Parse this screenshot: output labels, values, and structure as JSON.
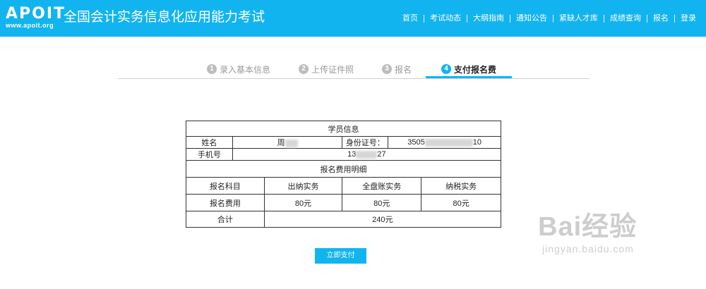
{
  "header": {
    "logo_main": "APOIT",
    "logo_sub": "www.apoit.org",
    "site_title": "全国会计实务信息化应用能力考试",
    "nav": [
      "首页",
      "考试动态",
      "大纲指南",
      "通知公告",
      "紧缺人才库",
      "成绩查询",
      "报名",
      "登录"
    ]
  },
  "steps": [
    {
      "num": "1",
      "label": "录入基本信息"
    },
    {
      "num": "2",
      "label": "上传证件照"
    },
    {
      "num": "3",
      "label": "报名"
    },
    {
      "num": "4",
      "label": "支付报名费"
    }
  ],
  "student": {
    "section_title": "学员信息",
    "name_label": "姓名",
    "name_value": "周",
    "id_label": "身份证号：",
    "id_prefix": "3505",
    "id_suffix": "10",
    "phone_label": "手机号",
    "phone_prefix": "13",
    "phone_suffix": "27"
  },
  "fees": {
    "section_title": "报名费用明细",
    "subject_label": "报名科目",
    "subjects": [
      "出纳实务",
      "全盘账实务",
      "纳税实务"
    ],
    "fee_label": "报名费用",
    "fee_values": [
      "80元",
      "80元",
      "80元"
    ],
    "total_label": "合计",
    "total_value": "240元"
  },
  "pay_button": "立即支付",
  "watermark": {
    "main": "Bai经验",
    "sub": "jingyan.baidu.com"
  },
  "colors": {
    "brand": "#12b4f0"
  }
}
